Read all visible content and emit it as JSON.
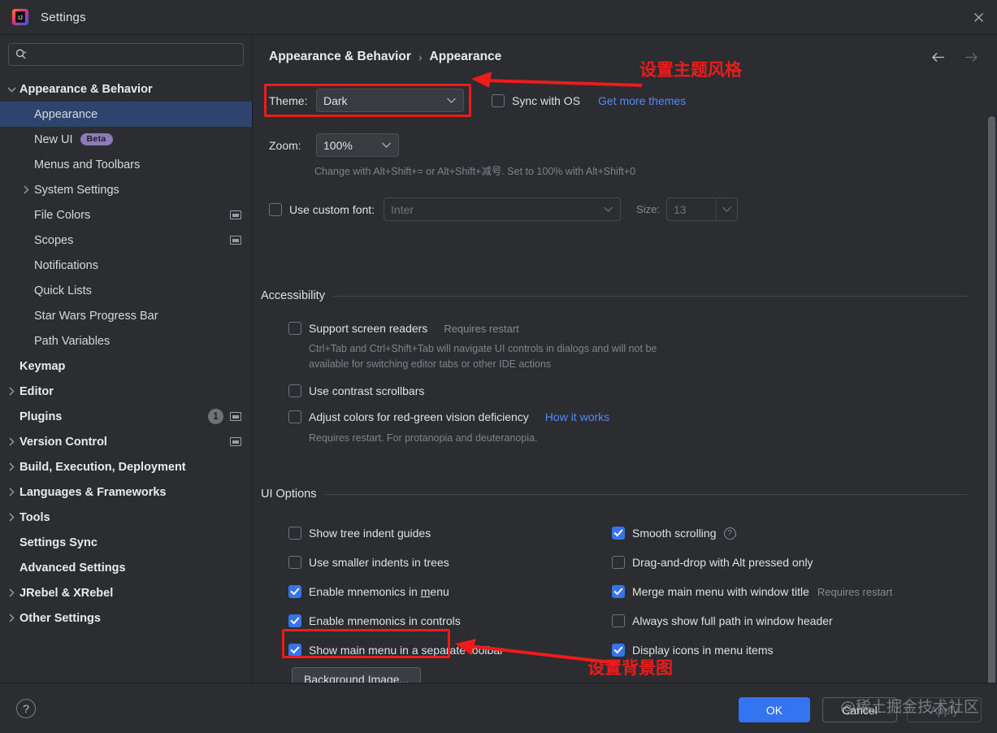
{
  "window": {
    "title": "Settings",
    "logo_icon": "intellij-idea-logo",
    "close_icon": "close-icon"
  },
  "sidebar": {
    "search": {
      "placeholder": "",
      "value": "",
      "icon": "search-icon"
    },
    "items": [
      {
        "label": "Appearance & Behavior",
        "level": 0,
        "arrow": "expanded",
        "selected": false
      },
      {
        "label": "Appearance",
        "level": 1,
        "arrow": "none",
        "selected": true
      },
      {
        "label": "New UI",
        "level": 1,
        "arrow": "none",
        "selected": false,
        "badge": "Beta"
      },
      {
        "label": "Menus and Toolbars",
        "level": 1,
        "arrow": "none",
        "selected": false
      },
      {
        "label": "System Settings",
        "level": 1,
        "arrow": "collapsed",
        "selected": false
      },
      {
        "label": "File Colors",
        "level": 1,
        "arrow": "none",
        "selected": false,
        "project_icon": true
      },
      {
        "label": "Scopes",
        "level": 1,
        "arrow": "none",
        "selected": false,
        "project_icon": true
      },
      {
        "label": "Notifications",
        "level": 1,
        "arrow": "none",
        "selected": false
      },
      {
        "label": "Quick Lists",
        "level": 1,
        "arrow": "none",
        "selected": false
      },
      {
        "label": "Star Wars Progress Bar",
        "level": 1,
        "arrow": "none",
        "selected": false
      },
      {
        "label": "Path Variables",
        "level": 1,
        "arrow": "none",
        "selected": false
      },
      {
        "label": "Keymap",
        "level": 0,
        "arrow": "none",
        "selected": false
      },
      {
        "label": "Editor",
        "level": 0,
        "arrow": "collapsed",
        "selected": false
      },
      {
        "label": "Plugins",
        "level": 0,
        "arrow": "none",
        "selected": false,
        "count": "1",
        "project_icon": true
      },
      {
        "label": "Version Control",
        "level": 0,
        "arrow": "collapsed",
        "selected": false,
        "project_icon": true
      },
      {
        "label": "Build, Execution, Deployment",
        "level": 0,
        "arrow": "collapsed",
        "selected": false
      },
      {
        "label": "Languages & Frameworks",
        "level": 0,
        "arrow": "collapsed",
        "selected": false
      },
      {
        "label": "Tools",
        "level": 0,
        "arrow": "collapsed",
        "selected": false
      },
      {
        "label": "Settings Sync",
        "level": 0,
        "arrow": "none",
        "selected": false
      },
      {
        "label": "Advanced Settings",
        "level": 0,
        "arrow": "none",
        "selected": false
      },
      {
        "label": "JRebel & XRebel",
        "level": 0,
        "arrow": "collapsed",
        "selected": false
      },
      {
        "label": "Other Settings",
        "level": 0,
        "arrow": "collapsed",
        "selected": false
      }
    ]
  },
  "main": {
    "breadcrumb": {
      "root": "Appearance & Behavior",
      "separator": "›",
      "leaf": "Appearance"
    },
    "nav": {
      "back_icon": "arrow-left-icon",
      "forward_icon": "arrow-right-icon"
    },
    "theme": {
      "label": "Theme:",
      "value": "Dark",
      "sync_with_os_label": "Sync with OS",
      "sync_with_os_checked": false,
      "get_more_themes_link": "Get more themes"
    },
    "zoom": {
      "label": "Zoom:",
      "value": "100%",
      "hint": "Change with Alt+Shift+= or Alt+Shift+减号. Set to 100% with Alt+Shift+0"
    },
    "font": {
      "use_custom_font_label": "Use custom font:",
      "use_custom_font_checked": false,
      "font_value": "Inter",
      "size_label": "Size:",
      "size_value": "13"
    },
    "accessibility": {
      "section_title": "Accessibility",
      "options": [
        {
          "label": "Support screen readers",
          "checked": false,
          "suffix": "Requires restart",
          "hint": "Ctrl+Tab and Ctrl+Shift+Tab will navigate UI controls in dialogs and will not be\navailable for switching editor tabs or other IDE actions"
        },
        {
          "label": "Use contrast scrollbars",
          "checked": false
        },
        {
          "label": "Adjust colors for red-green vision deficiency",
          "checked": false,
          "link": "How it works",
          "hint": "Requires restart. For protanopia and deuteranopia."
        }
      ]
    },
    "ui_options": {
      "section_title": "UI Options",
      "left_column": [
        {
          "label": "Show tree indent guides",
          "checked": false
        },
        {
          "label": "Use smaller indents in trees",
          "checked": false
        },
        {
          "label": "Enable mnemonics in menu",
          "checked": true,
          "mnemonic": "m"
        },
        {
          "label": "Enable mnemonics in controls",
          "checked": true
        },
        {
          "label": "Show main menu in a separate toolbar",
          "checked": true
        }
      ],
      "right_column": [
        {
          "label": "Smooth scrolling",
          "checked": true,
          "help_icon": "help-circle-icon"
        },
        {
          "label": "Drag-and-drop with Alt pressed only",
          "checked": false
        },
        {
          "label": "Merge main menu with window title",
          "checked": true,
          "suffix": "Requires restart"
        },
        {
          "label": "Always show full path in window header",
          "checked": false
        },
        {
          "label": "Display icons in menu items",
          "checked": true
        }
      ],
      "background_image_button": "Background Image..."
    }
  },
  "footer": {
    "help_icon": "question-mark-icon",
    "ok": "OK",
    "cancel": "Cancel",
    "apply": "Apply"
  },
  "annotations": [
    {
      "text": "设置主题风格",
      "color": "#ee1b1b"
    },
    {
      "text": "设置背景图",
      "color": "#ee1b1b"
    }
  ],
  "watermark": {
    "text": "@稀土掘金技术社区"
  }
}
